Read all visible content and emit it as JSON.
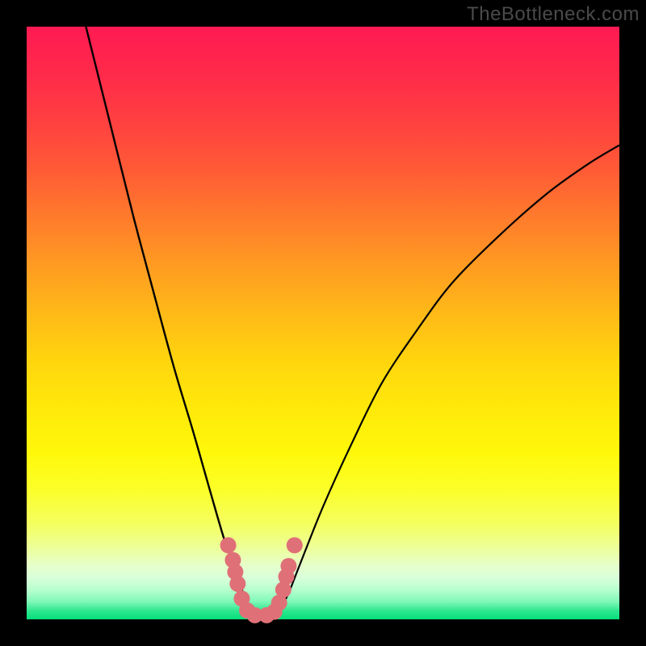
{
  "watermark": "TheBottleneck.com",
  "chart_data": {
    "type": "line",
    "title": "",
    "xlabel": "",
    "ylabel": "",
    "xlim": [
      0,
      100
    ],
    "ylim": [
      0,
      100
    ],
    "curve_left": {
      "x": [
        10,
        14,
        18,
        22,
        25,
        28,
        30,
        32,
        33.5,
        35,
        36,
        37,
        38
      ],
      "y": [
        100,
        84,
        68,
        53,
        42,
        32,
        25,
        18,
        13,
        9,
        6,
        3,
        0.5
      ]
    },
    "curve_right": {
      "x": [
        42,
        44,
        46,
        50,
        55,
        60,
        66,
        72,
        80,
        88,
        95,
        100
      ],
      "y": [
        0.5,
        4,
        9,
        19,
        30,
        40,
        49,
        57,
        65,
        72,
        77,
        80
      ]
    },
    "marker_group": {
      "color": "#e07078",
      "points": [
        {
          "x": 34.0,
          "y": 12.5
        },
        {
          "x": 34.8,
          "y": 10.0
        },
        {
          "x": 35.2,
          "y": 8.0
        },
        {
          "x": 35.6,
          "y": 6.0
        },
        {
          "x": 36.3,
          "y": 3.5
        },
        {
          "x": 37.2,
          "y": 1.5
        },
        {
          "x": 38.5,
          "y": 0.7
        },
        {
          "x": 40.5,
          "y": 0.7
        },
        {
          "x": 41.8,
          "y": 1.3
        },
        {
          "x": 42.6,
          "y": 2.8
        },
        {
          "x": 43.3,
          "y": 5.0
        },
        {
          "x": 43.8,
          "y": 7.2
        },
        {
          "x": 44.2,
          "y": 9.0
        },
        {
          "x": 45.2,
          "y": 12.5
        }
      ]
    },
    "gradient_stops": [
      {
        "pos": 0,
        "color": "#ff1a52"
      },
      {
        "pos": 50,
        "color": "#ffd000"
      },
      {
        "pos": 90,
        "color": "#f0ffb0"
      },
      {
        "pos": 100,
        "color": "#06de7a"
      }
    ]
  }
}
